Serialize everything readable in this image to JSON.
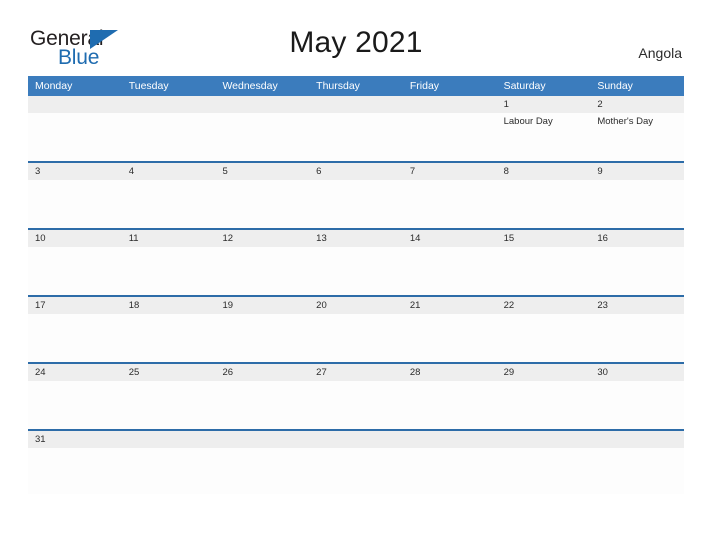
{
  "brand": {
    "name_part1": "General",
    "name_part2": "Blue",
    "flag_icon": "triangle-flag-icon",
    "color_primary": "#1f6cb0",
    "color_text": "#231f20"
  },
  "header": {
    "title": "May 2021",
    "country": "Angola"
  },
  "calendar": {
    "header_bg": "#3b7cbd",
    "row_divider": "#2d6ca8",
    "daystrip_bg": "#eeeeee",
    "weekdays": [
      "Monday",
      "Tuesday",
      "Wednesday",
      "Thursday",
      "Friday",
      "Saturday",
      "Sunday"
    ],
    "weeks": [
      [
        {
          "num": "",
          "event": ""
        },
        {
          "num": "",
          "event": ""
        },
        {
          "num": "",
          "event": ""
        },
        {
          "num": "",
          "event": ""
        },
        {
          "num": "",
          "event": ""
        },
        {
          "num": "1",
          "event": "Labour Day"
        },
        {
          "num": "2",
          "event": "Mother's Day"
        }
      ],
      [
        {
          "num": "3",
          "event": ""
        },
        {
          "num": "4",
          "event": ""
        },
        {
          "num": "5",
          "event": ""
        },
        {
          "num": "6",
          "event": ""
        },
        {
          "num": "7",
          "event": ""
        },
        {
          "num": "8",
          "event": ""
        },
        {
          "num": "9",
          "event": ""
        }
      ],
      [
        {
          "num": "10",
          "event": ""
        },
        {
          "num": "11",
          "event": ""
        },
        {
          "num": "12",
          "event": ""
        },
        {
          "num": "13",
          "event": ""
        },
        {
          "num": "14",
          "event": ""
        },
        {
          "num": "15",
          "event": ""
        },
        {
          "num": "16",
          "event": ""
        }
      ],
      [
        {
          "num": "17",
          "event": ""
        },
        {
          "num": "18",
          "event": ""
        },
        {
          "num": "19",
          "event": ""
        },
        {
          "num": "20",
          "event": ""
        },
        {
          "num": "21",
          "event": ""
        },
        {
          "num": "22",
          "event": ""
        },
        {
          "num": "23",
          "event": ""
        }
      ],
      [
        {
          "num": "24",
          "event": ""
        },
        {
          "num": "25",
          "event": ""
        },
        {
          "num": "26",
          "event": ""
        },
        {
          "num": "27",
          "event": ""
        },
        {
          "num": "28",
          "event": ""
        },
        {
          "num": "29",
          "event": ""
        },
        {
          "num": "30",
          "event": ""
        }
      ],
      [
        {
          "num": "31",
          "event": ""
        },
        {
          "num": "",
          "event": ""
        },
        {
          "num": "",
          "event": ""
        },
        {
          "num": "",
          "event": ""
        },
        {
          "num": "",
          "event": ""
        },
        {
          "num": "",
          "event": ""
        },
        {
          "num": "",
          "event": ""
        }
      ]
    ]
  }
}
